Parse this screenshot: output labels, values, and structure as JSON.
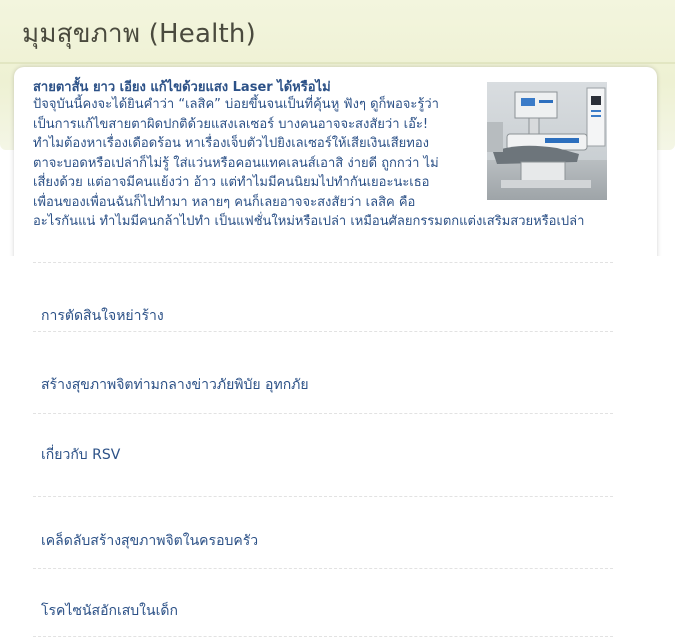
{
  "page": {
    "title": "มุมสุขภาพ (Health)"
  },
  "feature": {
    "headline": "สายตาสั้น ยาว เอียง แก้ไขด้วยแสง Laser ได้หรือไม่",
    "body_lines": [
      "ปัจจุบันนี้คงจะได้ยินคำว่า “เลสิค” บ่อยขึ้นจนเป็นที่คุ้นหู ฟังๆ ดูก็พอจะรู้ว่า",
      "เป็นการแก้ไขสายตาผิดปกติด้วยแสงเลเซอร์ บางคนอาจจะสงสัยว่า เอ๊ะ!",
      "ทำไมต้องหาเรื่องเดือดร้อน หาเรื่องเจ็บตัวไปยิงเลเซอร์ให้เสียเงินเสียทอง",
      "ตาจะบอดหรือเปล่าก็ไม่รู้ ใส่แว่นหรือคอนแทคเลนส์เอาสิ ง่ายดี ถูกกว่า ไม่",
      "เสี่ยงด้วย แต่อาจมีคนแย้งว่า อ้าว แต่ทำไมมีคนนิยมไปทำกันเยอะนะเธอ",
      "เพื่อนของเพื่อนฉันก็ไปทำมา หลายๆ คนก็เลยอาจจะสงสัยว่า เลสิค คือ"
    ],
    "body_tail": "อะไรกันแน่ ทำไมมีคนกล้าไปทำ เป็นแฟชั่นใหม่หรือเปล่า เหมือนศัลยกรรมตกแต่งเสริมสวยหรือเปล่า"
  },
  "links": [
    {
      "label": "การตัดสินใจหย่าร้าง"
    },
    {
      "label": "สร้างสุขภาพจิตท่ามกลางข่าวภัยพิบัย อุทกภัย"
    },
    {
      "label": "เกี่ยวกับ RSV"
    },
    {
      "label": "เคล็ดลับสร้างสุขภาพจิตในครอบครัว"
    },
    {
      "label": "โรคไซนัสอักเสบในเด็ก"
    }
  ],
  "colors": {
    "link": "#2c5187",
    "title": "#4a4a3e",
    "header_band": "#eef1d3"
  },
  "icons": {
    "feature_photo": "laser-eye-surgery-machine-photo"
  }
}
